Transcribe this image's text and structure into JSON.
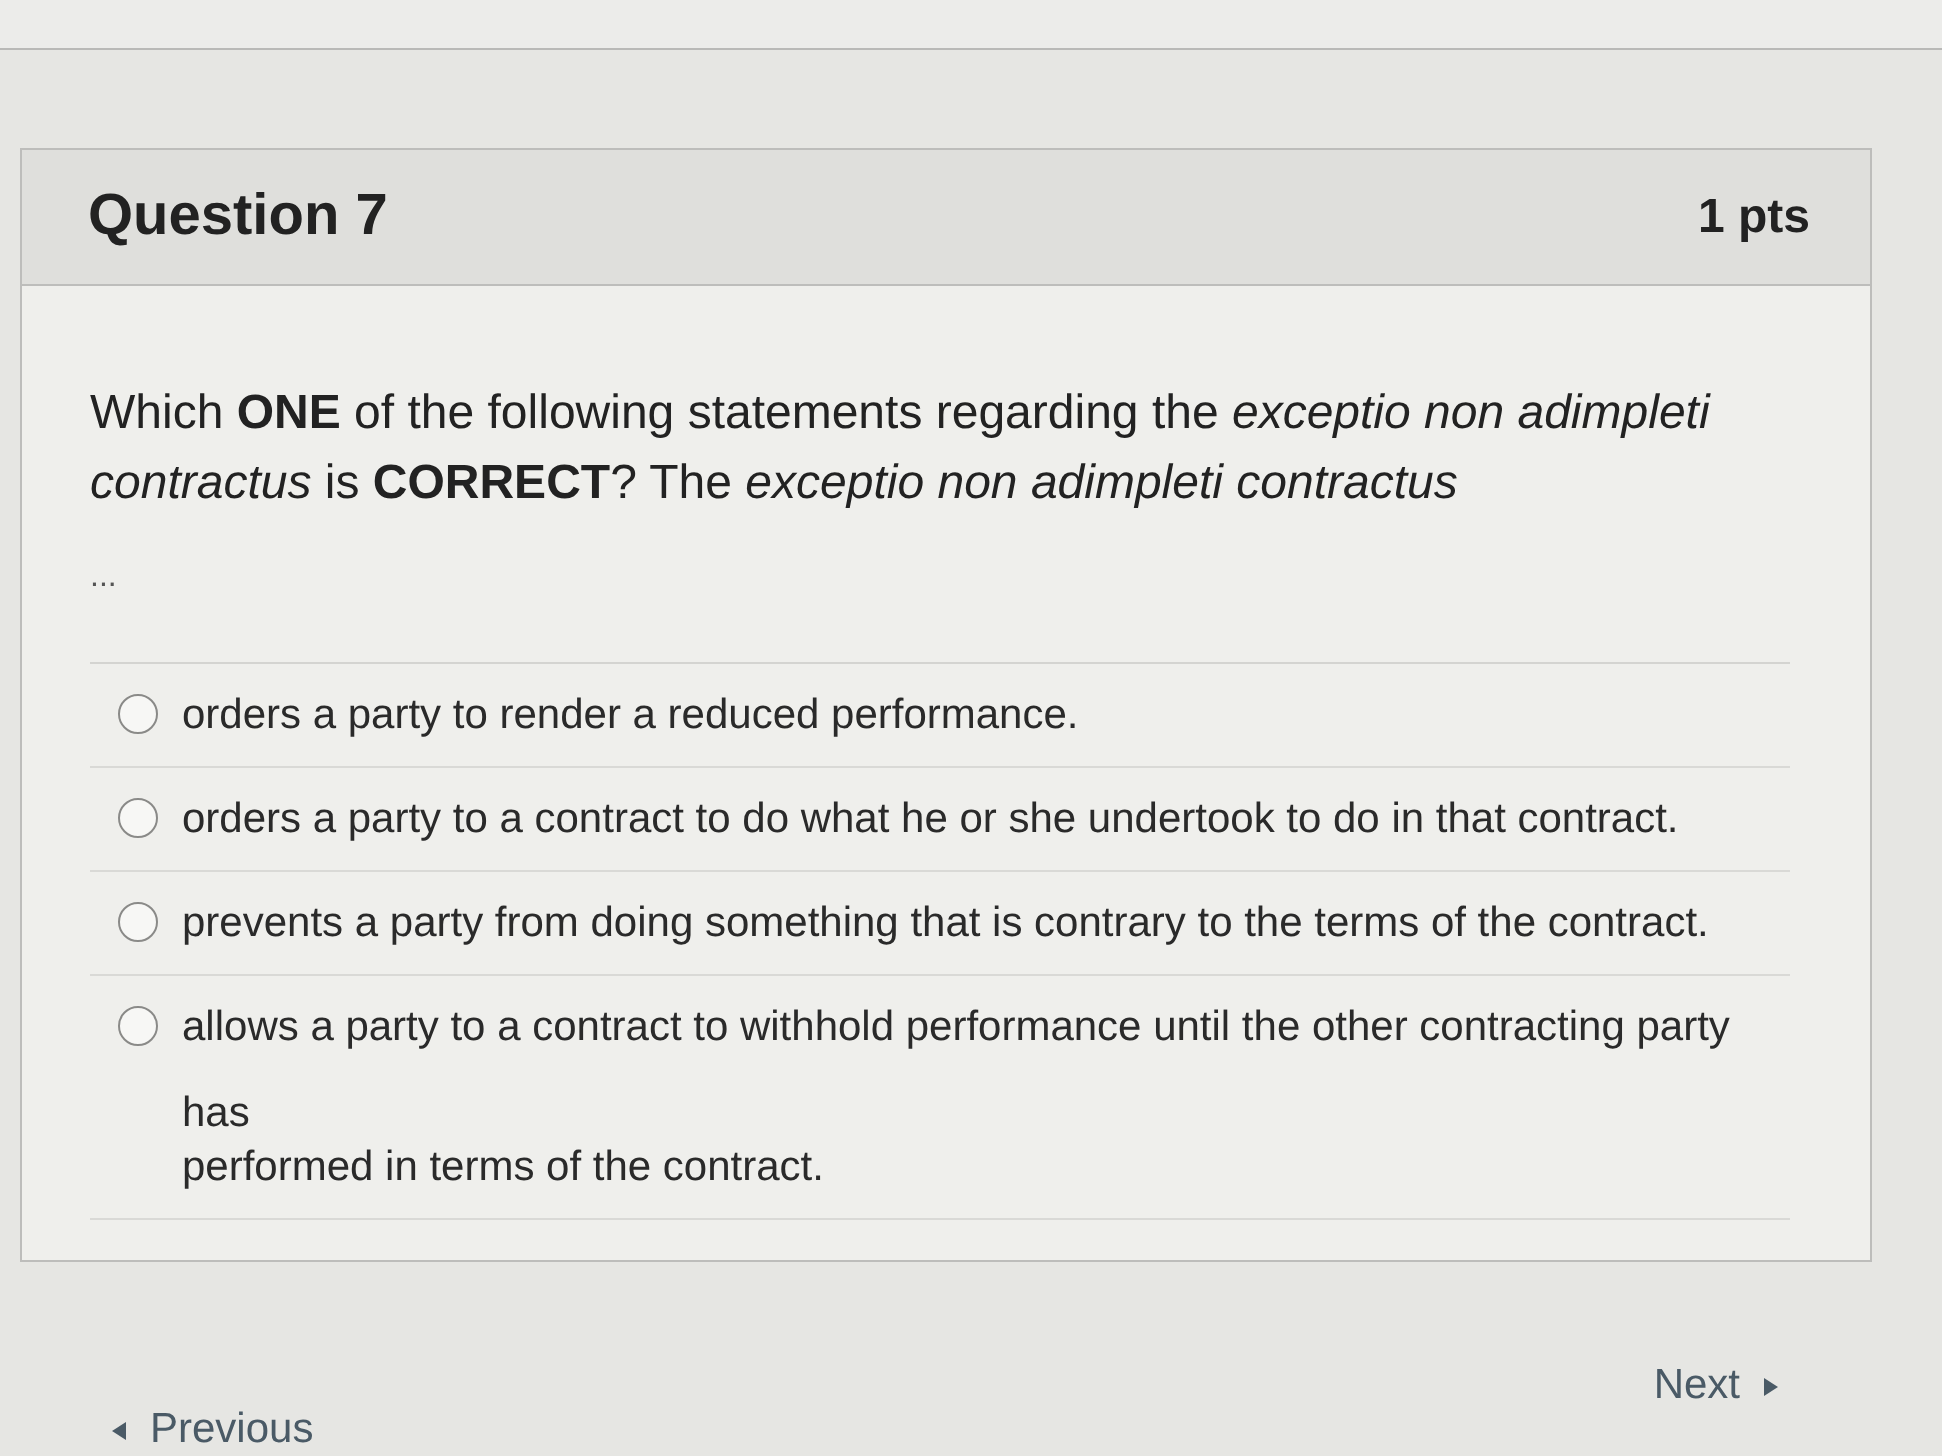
{
  "question": {
    "title": "Question 7",
    "points": "1 pts",
    "text": "Which **ONE** of the following statements regarding the *exceptio non adimpleti contractus* is **CORRECT**? The *exceptio non adimpleti contractus*",
    "more": "..."
  },
  "answers": [
    {
      "lines": [
        "orders a party to render a reduced performance."
      ],
      "selected": false
    },
    {
      "lines": [
        "orders a party to a contract to do what he or she undertook to do in that contract."
      ],
      "selected": false
    },
    {
      "lines": [
        "prevents a party from doing something that is contrary to the terms of the contract."
      ],
      "selected": false
    },
    {
      "lines": [
        "allows a party to a contract to withhold performance until the other contracting party",
        "has",
        "performed in terms of the contract."
      ],
      "selected": false
    }
  ],
  "navigation": {
    "previous": "Previous",
    "next": "Next"
  }
}
